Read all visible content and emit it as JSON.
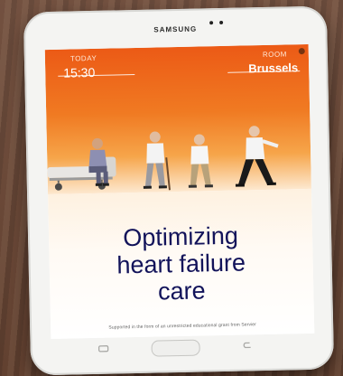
{
  "device": {
    "brand": "SAMSUNG"
  },
  "screen": {
    "today_label": "TODAY",
    "time": "15:30",
    "room_label": "ROOM",
    "city": "Brussels",
    "headline": [
      "Optimizing",
      "heart failure",
      "care"
    ],
    "support_text": "Supported in the form of an unrestricted educational grant from Servier"
  },
  "colors": {
    "banner_top": "#ec5a16",
    "banner_bottom": "#f6a54a",
    "headline": "#12135a"
  },
  "icons": {
    "recent_apps": "recent-apps-icon",
    "back": "back-icon",
    "home": "home-button"
  }
}
